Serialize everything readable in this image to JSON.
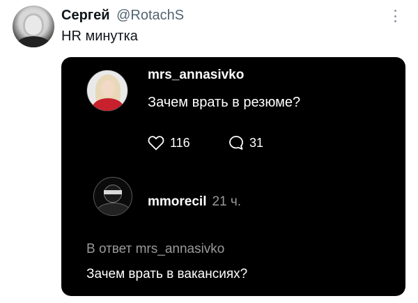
{
  "tweet": {
    "author_name": "Сергей",
    "author_handle": "@RotachS",
    "text": "HR минутка",
    "more_icon": "more-vertical-icon"
  },
  "card": {
    "post": {
      "username": "mrs_annasivko",
      "question": "Зачем врать в резюме?",
      "likes": "116",
      "comments": "31",
      "like_icon": "heart-icon",
      "comment_icon": "comment-bubble-icon"
    },
    "reply": {
      "username": "mmorecil",
      "time": "21 ч.",
      "reply_to": "В ответ mrs_annasivko",
      "text": "Зачем врать в вакансиях?"
    }
  },
  "colors": {
    "background": "#ffffff",
    "card_background": "#000000",
    "handle_gray": "#536471",
    "muted_gray": "#9a9a9a"
  }
}
